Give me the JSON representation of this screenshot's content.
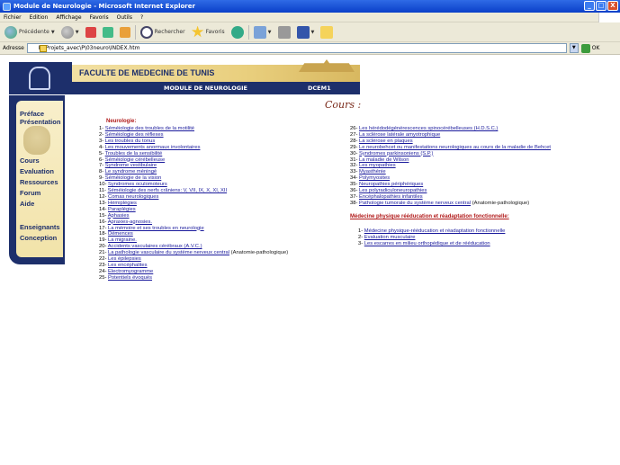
{
  "window": {
    "title": "Module de Neurologie - Microsoft Internet Explorer",
    "min_label": "_",
    "max_label": "□",
    "close_label": "X"
  },
  "menu": {
    "items": [
      "Fichier",
      "Edition",
      "Affichage",
      "Favoris",
      "Outils",
      "?"
    ]
  },
  "toolbar": {
    "back_label": "Précédente",
    "search_label": "Rechercher",
    "favorites_label": "Favoris"
  },
  "address": {
    "label": "Adresse",
    "value": "E:\\Projets_avec\\P\\03neuro\\INDEX.htm",
    "go_label": "OK"
  },
  "header": {
    "faculty": "FACULTE DE MEDECINE DE TUNIS",
    "module": "MODULE DE NEUROLOGIE",
    "level": "DCEM1"
  },
  "sidebar": {
    "items": [
      {
        "label": "Préface"
      },
      {
        "label": "Présentation"
      },
      {
        "label": "Cours"
      },
      {
        "label": "Evaluation"
      },
      {
        "label": "Ressources"
      },
      {
        "label": "Forum"
      },
      {
        "label": "Aide"
      },
      {
        "label": "Enseignants"
      },
      {
        "label": "Conception"
      }
    ]
  },
  "main": {
    "heading": "Cours :",
    "neurologie_title": "Neurologie:",
    "mpr_title": "Médecine physique rééducation et réadaptation fonctionnelle:",
    "neurologie_left": [
      {
        "num": "1-",
        "text": "Séméiologie des troubles de la motilité",
        "extra": ""
      },
      {
        "num": "2-",
        "text": "Séméiologie des réflexes",
        "extra": ""
      },
      {
        "num": "3-",
        "text": "Les troubles du tonus",
        "extra": ""
      },
      {
        "num": "4-",
        "text": "Les mouvements anormaux involontaires",
        "extra": ""
      },
      {
        "num": "5-",
        "text": "Troubles de la sensibilité",
        "extra": ""
      },
      {
        "num": "6-",
        "text": "Séméiologie cérébelleuse",
        "extra": ""
      },
      {
        "num": "7-",
        "text": "Syndrome vestibulaire",
        "extra": ""
      },
      {
        "num": "8-",
        "text": "Le syndrome méningé",
        "extra": ""
      },
      {
        "num": "9-",
        "text": "Séméiologie de la vision",
        "extra": ""
      },
      {
        "num": "10-",
        "text": "Syndromes oculomoteurs",
        "extra": ""
      },
      {
        "num": "11-",
        "text": "Séméiologie des nerfs crâniens: V, VII, IX, X, XI, XII",
        "extra": ""
      },
      {
        "num": "12-",
        "text": "Comas neurologiques",
        "extra": ""
      },
      {
        "num": "13-",
        "text": "Hémiplégies",
        "extra": ""
      },
      {
        "num": "14-",
        "text": "Paraplégies",
        "extra": ""
      },
      {
        "num": "15-",
        "text": "Aphasies",
        "extra": ""
      },
      {
        "num": "16-",
        "text": "Apraxies-agnosies.",
        "extra": ""
      },
      {
        "num": "17-",
        "text": "La mémoire et ses troubles en neurologie",
        "extra": ""
      },
      {
        "num": "18-",
        "text": "Démences",
        "extra": ""
      },
      {
        "num": "19-",
        "text": "La migraine.",
        "extra": ""
      },
      {
        "num": "20-",
        "text": "Accidents vasculaires cérébraux (A.V.C.)",
        "extra": ""
      },
      {
        "num": "21-",
        "text": "La pathologie vasculaire du système nerveux central",
        "extra": " (Anatomie-pathologique)"
      },
      {
        "num": "22-",
        "text": "Les épilepsies",
        "extra": ""
      },
      {
        "num": "23-",
        "text": "Les encéphalites",
        "extra": ""
      },
      {
        "num": "24-",
        "text": "Electromyogramme",
        "extra": ""
      },
      {
        "num": "25-",
        "text": "Potentiels évoqués",
        "extra": ""
      }
    ],
    "neurologie_right": [
      {
        "num": "26-",
        "text": "Les hérédodégénérescences spinocérébelleuses (H.D.S.C.)",
        "extra": ""
      },
      {
        "num": "27-",
        "text": "La sclérose latérale amyotrophique",
        "extra": ""
      },
      {
        "num": "28-",
        "text": "La sclérose en plaques",
        "extra": ""
      },
      {
        "num": "29-",
        "text": "Le neurobehcet ou manifestations neurologiques au cours de la maladie de Behcet",
        "extra": ""
      },
      {
        "num": "30-",
        "text": "Syndromes parkinsoniens (S.P.)",
        "extra": ""
      },
      {
        "num": "31-",
        "text": "La maladie de Wilson",
        "extra": ""
      },
      {
        "num": "32-",
        "text": "Les myopathies",
        "extra": ""
      },
      {
        "num": "33-",
        "text": "Myasthénie",
        "extra": ""
      },
      {
        "num": "34-",
        "text": "Polymyosites",
        "extra": ""
      },
      {
        "num": "35-",
        "text": "Neuropathies périphériques",
        "extra": ""
      },
      {
        "num": "36-",
        "text": "Les polyradiculoneuropathies",
        "extra": ""
      },
      {
        "num": "37-",
        "text": "Encéphalopathies infantiles",
        "extra": ""
      },
      {
        "num": "38-",
        "text": "Pathologie tumorale du système nerveux central",
        "extra": " (Anatomie-pathologique)"
      }
    ],
    "mpr_items": [
      {
        "num": "1-",
        "text": "Médecine physique-rééducation et réadaptation fonctionnelle",
        "extra": ""
      },
      {
        "num": "2-",
        "text": "Evaluation musculaire",
        "extra": ""
      },
      {
        "num": "3-",
        "text": "Les escarres en milieu orthopédique et de rééducation",
        "extra": ""
      }
    ]
  }
}
